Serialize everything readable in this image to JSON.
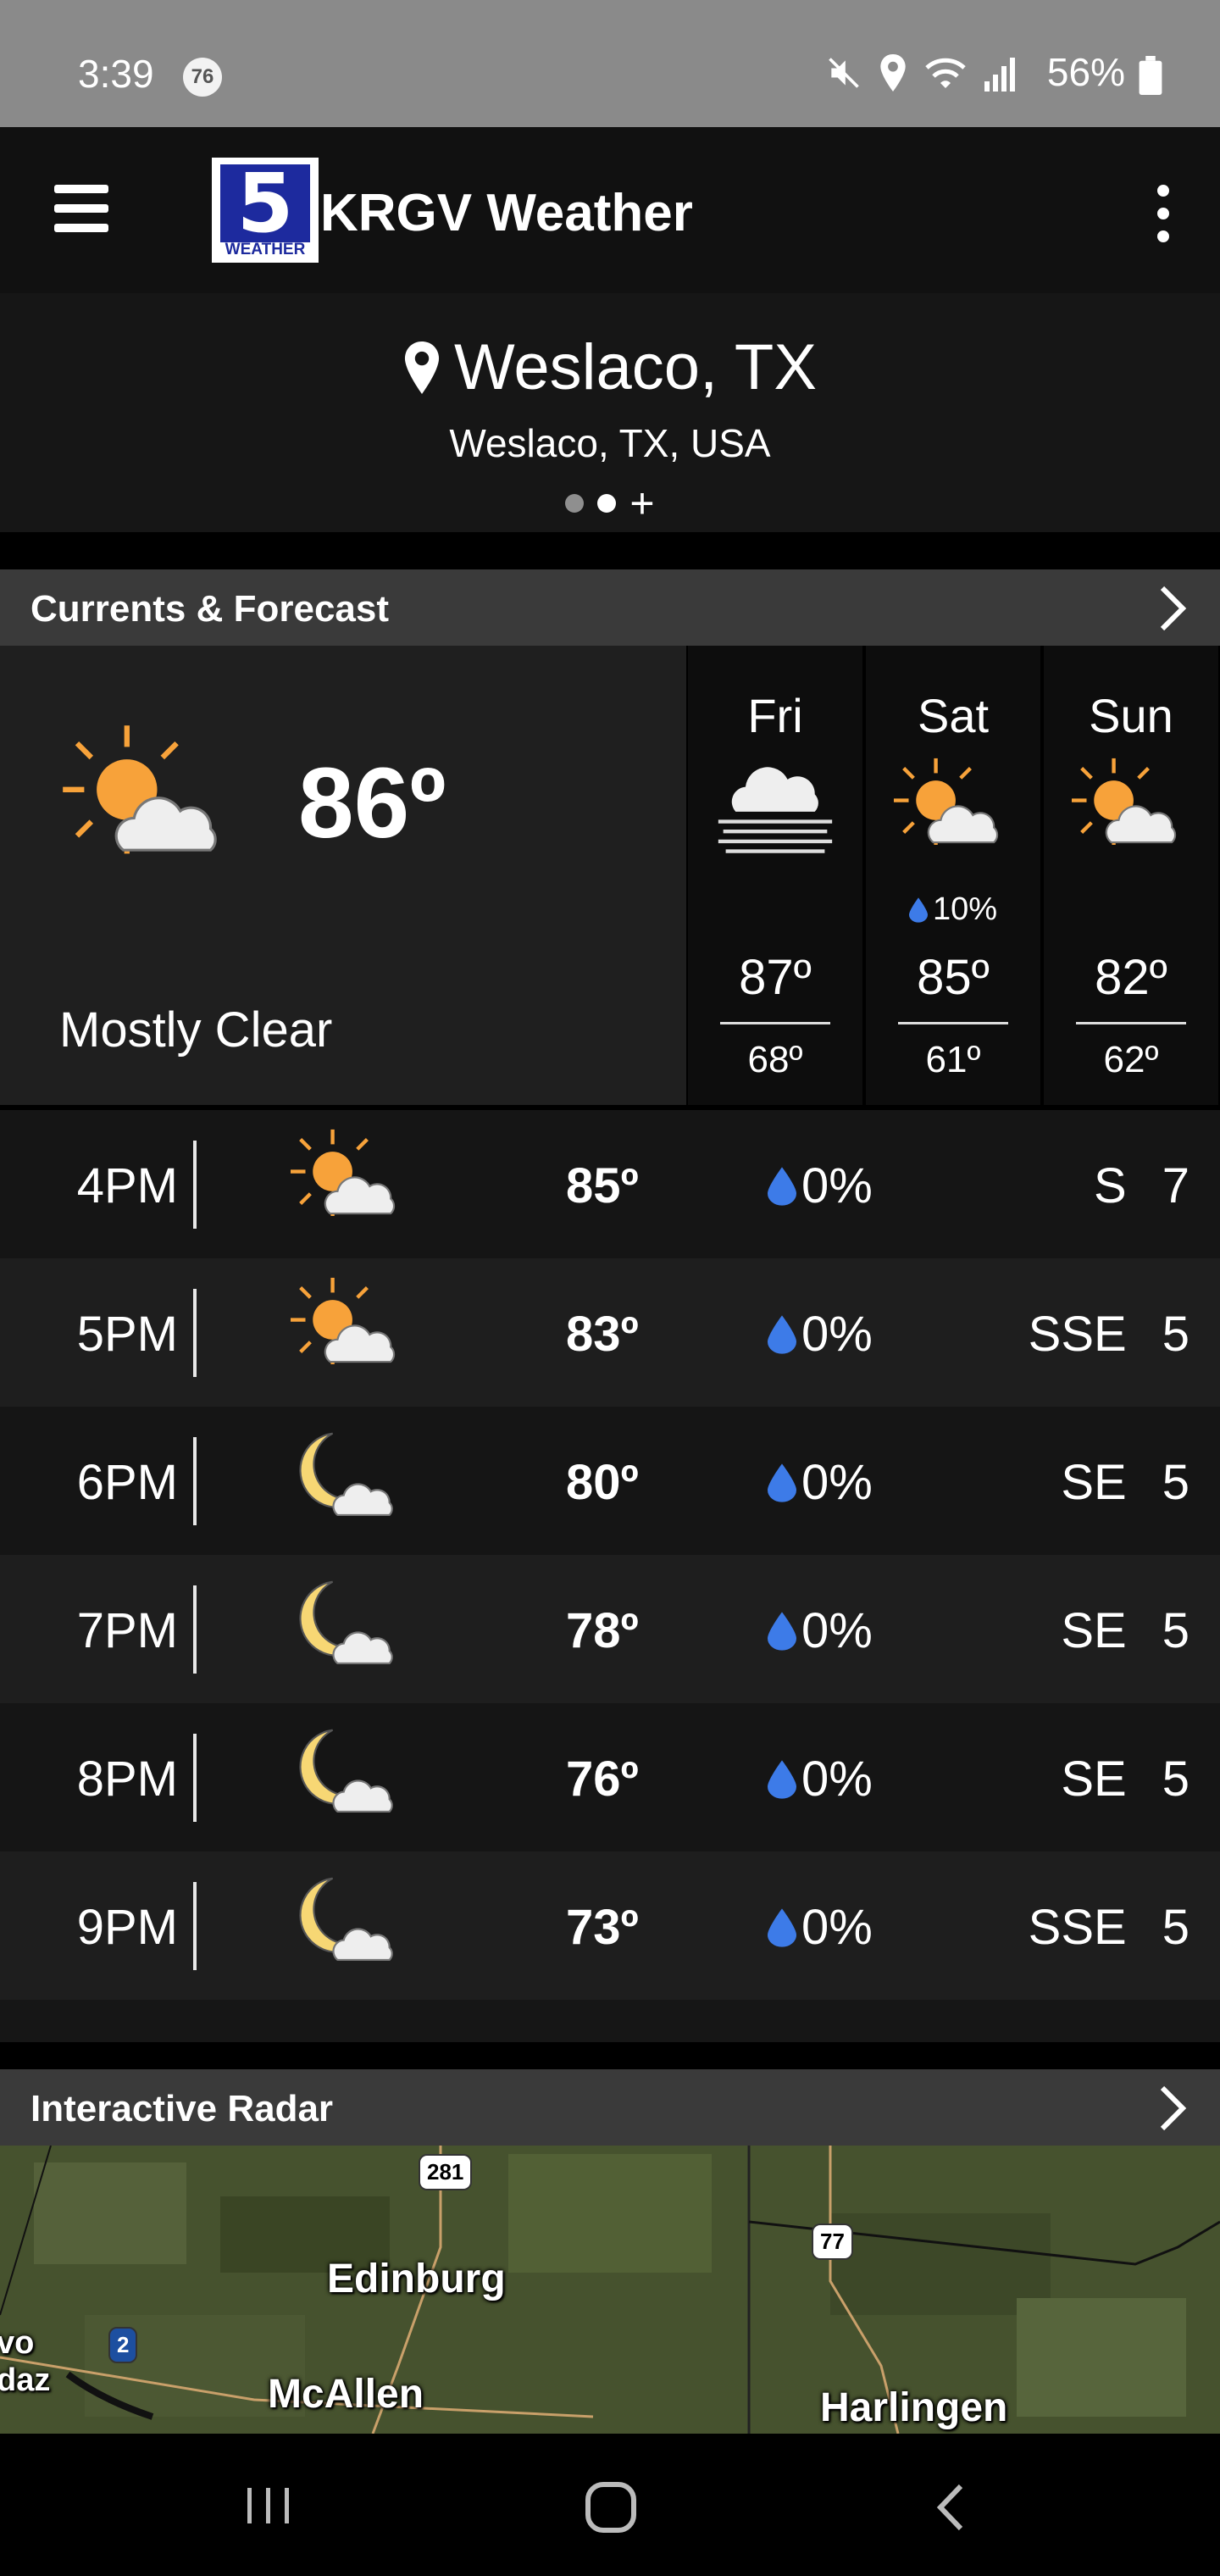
{
  "status_bar": {
    "time": "3:39",
    "notification_badge": "76",
    "battery": "56%"
  },
  "app_bar": {
    "title": "KRGV Weather",
    "logo_number": "5",
    "logo_text": "WEATHER"
  },
  "location": {
    "name": "Weslaco, TX",
    "full": "Weslaco, TX, USA",
    "page_count": 2,
    "active_page": 2
  },
  "currents_section": {
    "label": "Currents & Forecast"
  },
  "current": {
    "temp": "86º",
    "condition": "Mostly Clear",
    "icon": "partly-sunny-icon"
  },
  "forecast": [
    {
      "day": "Fri",
      "icon": "fog-icon",
      "precip": "",
      "hi": "87º",
      "lo": "68º"
    },
    {
      "day": "Sat",
      "icon": "partly-sunny-icon",
      "precip": "10%",
      "hi": "85º",
      "lo": "61º"
    },
    {
      "day": "Sun",
      "icon": "partly-sunny-icon",
      "precip": "",
      "hi": "82º",
      "lo": "62º"
    }
  ],
  "hourly": [
    {
      "time": "4PM",
      "icon": "partly-sunny-icon",
      "temp": "85º",
      "precip": "0%",
      "wind_dir": "S",
      "wind_speed": "7"
    },
    {
      "time": "5PM",
      "icon": "partly-sunny-icon",
      "temp": "83º",
      "precip": "0%",
      "wind_dir": "SSE",
      "wind_speed": "5"
    },
    {
      "time": "6PM",
      "icon": "moon-cloud-icon",
      "temp": "80º",
      "precip": "0%",
      "wind_dir": "SE",
      "wind_speed": "5"
    },
    {
      "time": "7PM",
      "icon": "moon-cloud-icon",
      "temp": "78º",
      "precip": "0%",
      "wind_dir": "SE",
      "wind_speed": "5"
    },
    {
      "time": "8PM",
      "icon": "moon-cloud-icon",
      "temp": "76º",
      "precip": "0%",
      "wind_dir": "SE",
      "wind_speed": "5"
    },
    {
      "time": "9PM",
      "icon": "moon-cloud-icon",
      "temp": "73º",
      "precip": "0%",
      "wind_dir": "SSE",
      "wind_speed": "5"
    }
  ],
  "radar_section": {
    "label": "Interactive Radar",
    "map_labels": [
      "Edinburg",
      "McAllen",
      "Harlingen"
    ],
    "highway_shields": [
      "281",
      "2",
      "77"
    ],
    "cut_labels": [
      "vo",
      "daz"
    ]
  },
  "colors": {
    "accent_blue": "#3d7be8",
    "sun_orange": "#f7a23a",
    "moon_yellow": "#f7d774",
    "logo_blue": "#1d2a9e"
  }
}
